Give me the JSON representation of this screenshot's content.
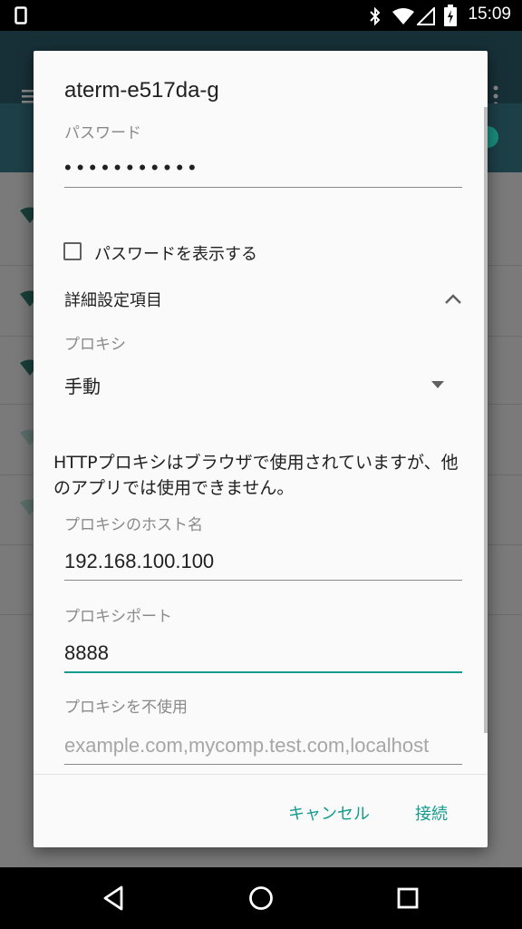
{
  "status_bar": {
    "time": "15:09",
    "icons": [
      "phone-icon",
      "bluetooth-icon",
      "wifi-icon",
      "signal-icon",
      "battery-icon"
    ]
  },
  "dialog": {
    "title": "aterm-e517da-g",
    "password": {
      "label": "パスワード",
      "masked_value": "•••••••••••"
    },
    "show_password": {
      "label": "パスワードを表示する",
      "checked": false
    },
    "advanced": {
      "label": "詳細設定項目",
      "expanded": true
    },
    "proxy": {
      "label": "プロキシ",
      "selected": "手動"
    },
    "http_proxy_note": "HTTPプロキシはブラウザで使用されていますが、他のアプリでは使用できません。",
    "proxy_host": {
      "label": "プロキシのホスト名",
      "value": "192.168.100.100"
    },
    "proxy_port": {
      "label": "プロキシポート",
      "value": "8888"
    },
    "proxy_bypass": {
      "label": "プロキシを不使用",
      "placeholder": "example.com,mycomp.test.com,localhost"
    },
    "buttons": {
      "cancel": "キャンセル",
      "connect": "接続"
    }
  },
  "colors": {
    "accent": "#139b8e",
    "app_bar": "#173037"
  }
}
